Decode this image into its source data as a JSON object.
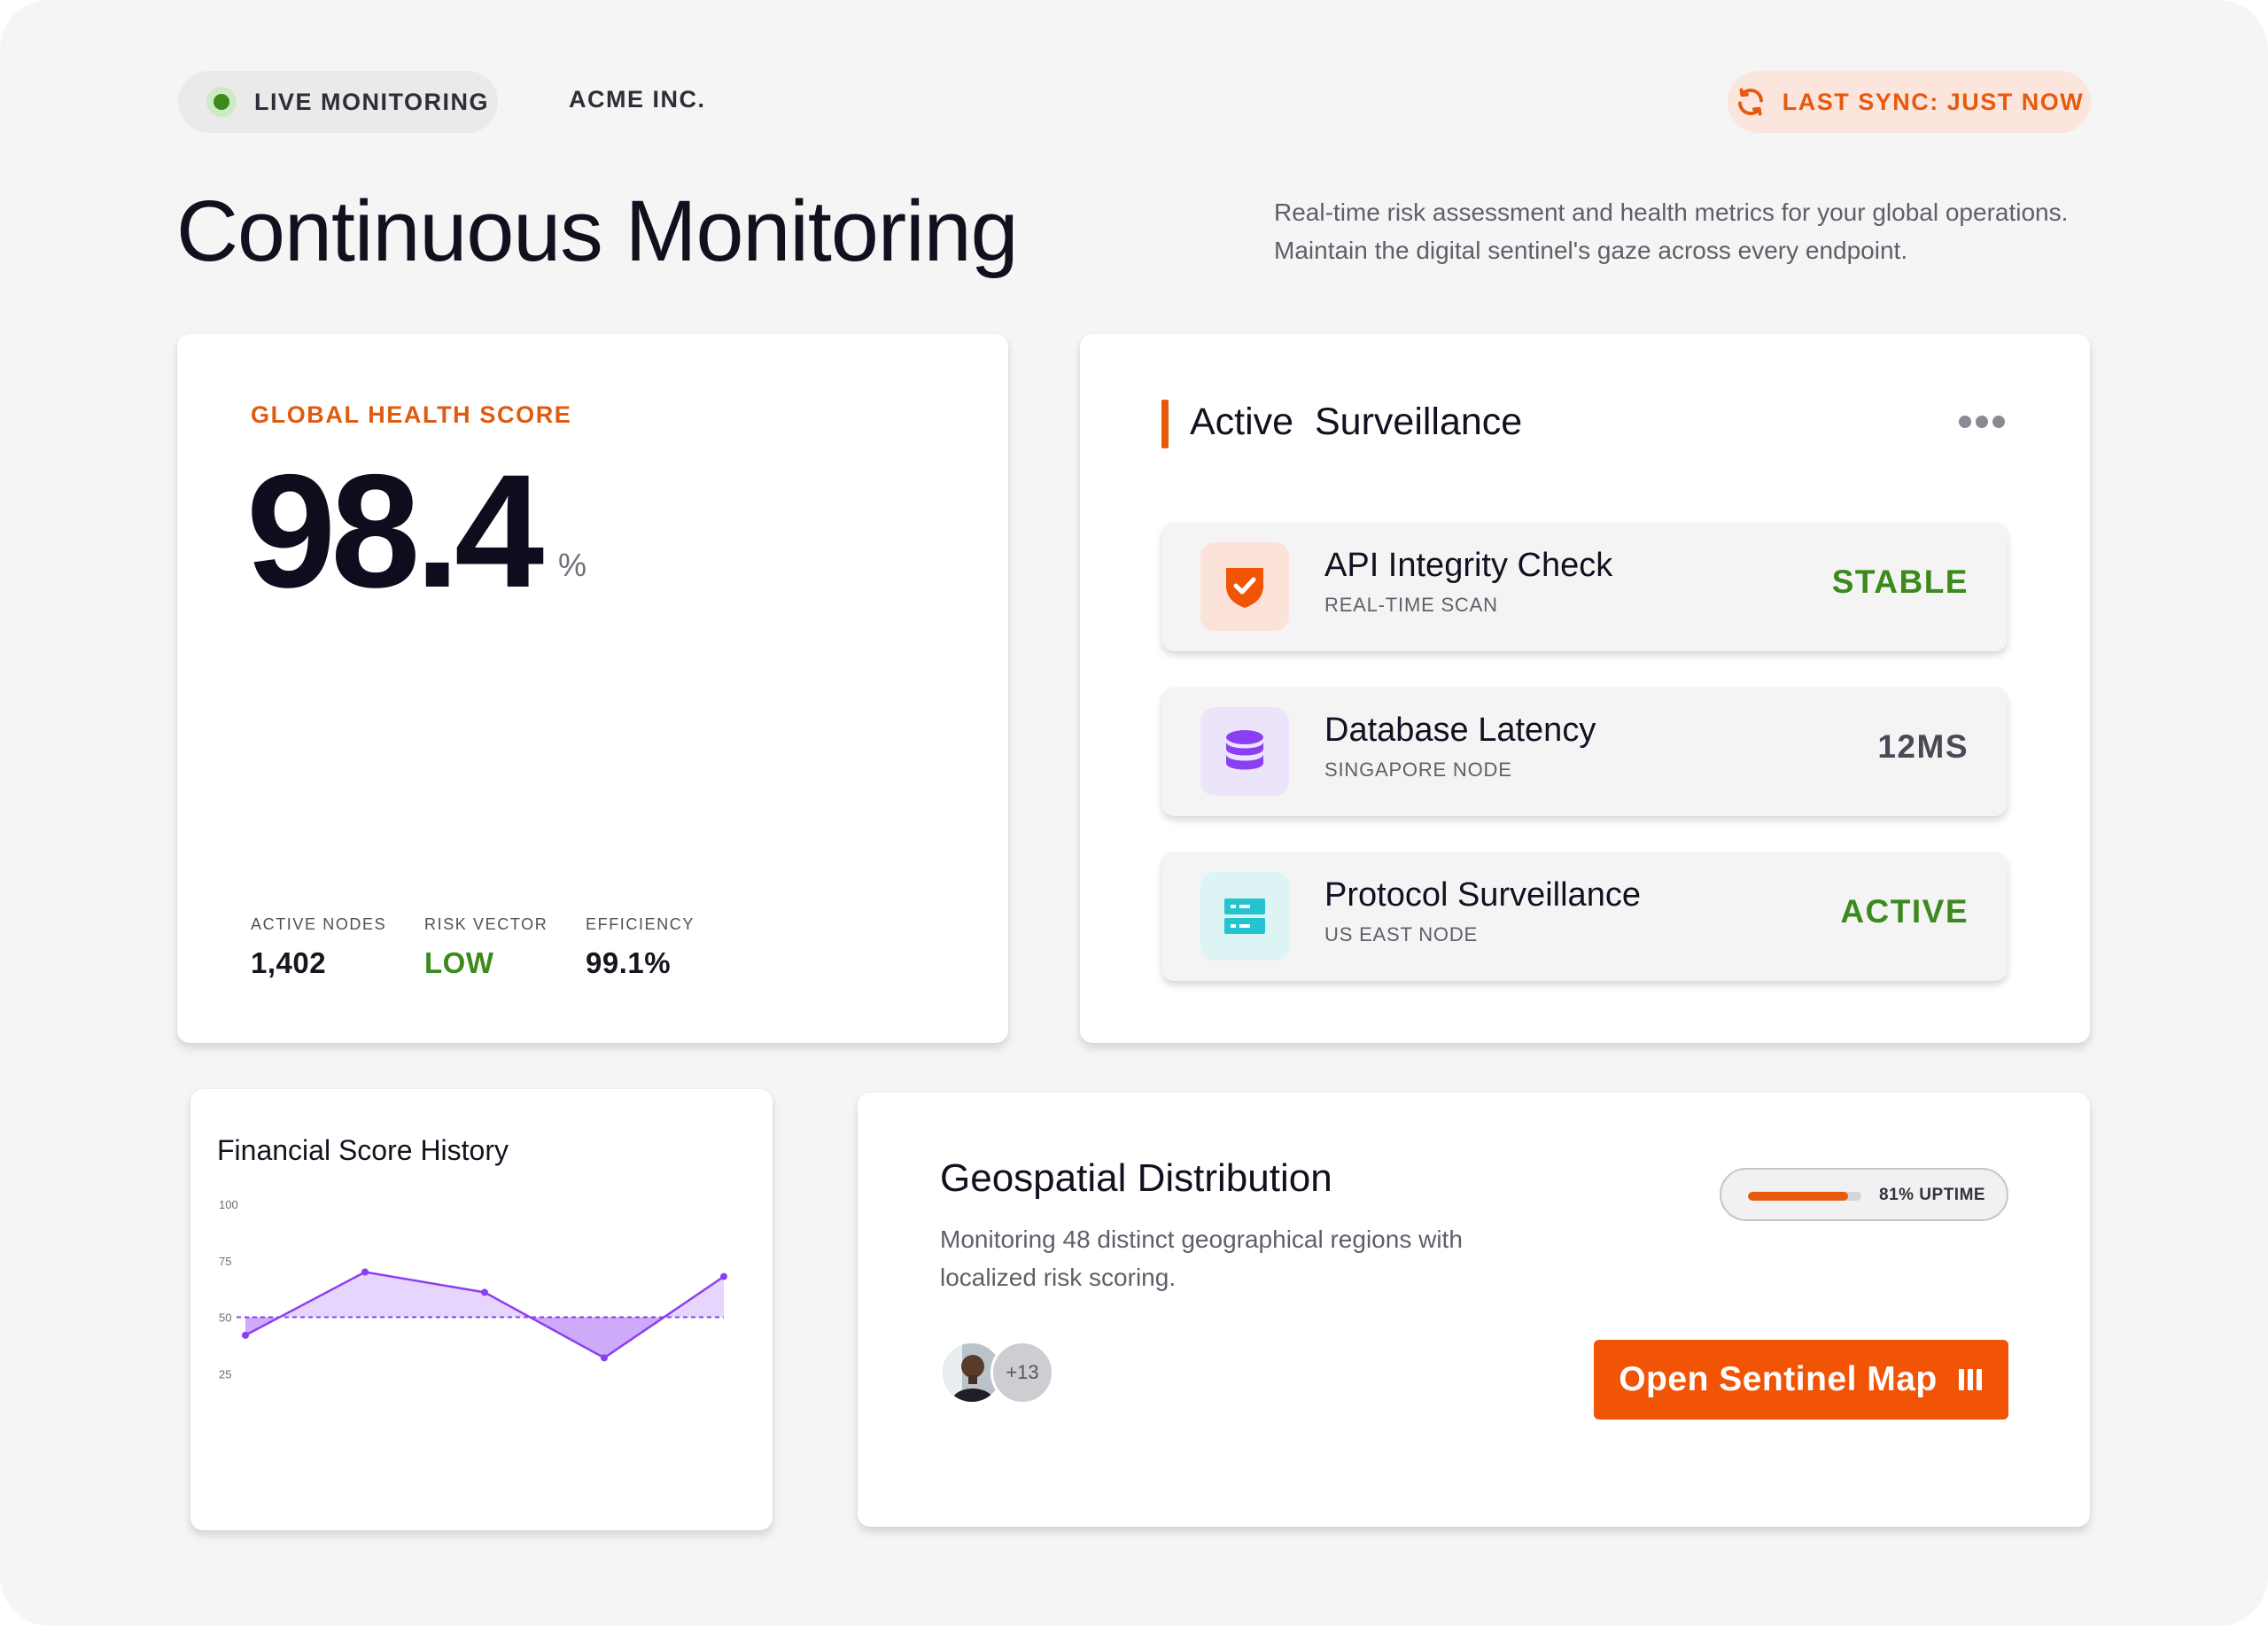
{
  "header": {
    "live_label": "LIVE MONITORING",
    "company": "ACME INC.",
    "sync_label": "LAST SYNC: JUST NOW",
    "live_color": "#3c8a1c",
    "accent_color": "#e8590c"
  },
  "page": {
    "title": "Continuous Monitoring",
    "description": "Real-time risk assessment and health metrics for your global operations. Maintain the digital sentinel's gaze across every endpoint."
  },
  "health": {
    "label": "GLOBAL HEALTH SCORE",
    "score": "98.4",
    "unit": "%",
    "stats": [
      {
        "label": "ACTIVE NODES",
        "value": "1,402"
      },
      {
        "label": "RISK VECTOR",
        "value": "LOW"
      },
      {
        "label": "EFFICIENCY",
        "value": "99.1%"
      }
    ]
  },
  "surveillance": {
    "title": "Active  Surveillance",
    "more_icon": "more-horizontal-icon",
    "items": [
      {
        "name": "API Integrity Check",
        "sub": "REAL-TIME SCAN",
        "status": "STABLE",
        "icon": "shield-check-icon",
        "status_color": "#3c8a1c",
        "icon_bg": "#fbe3da",
        "icon_color": "#f25406"
      },
      {
        "name": "Database Latency",
        "sub": "SINGAPORE NODE",
        "status": "12MS",
        "icon": "database-icon",
        "status_color": "#4a4a55",
        "icon_bg": "#ece4fb",
        "icon_color": "#8b3ff2"
      },
      {
        "name": "Protocol Surveillance",
        "sub": "US EAST NODE",
        "status": "ACTIVE",
        "icon": "server-icon",
        "status_color": "#3c8a1c",
        "icon_bg": "#ddf4f4",
        "icon_color": "#25c3d0"
      }
    ]
  },
  "financial": {
    "title": "Financial Score History",
    "chart_data": {
      "type": "area",
      "title": "Financial Score History",
      "y_ticks": [
        "100",
        "75",
        "50",
        "25"
      ],
      "ylim": [
        0,
        100
      ],
      "baseline": 50,
      "x": [
        0,
        1,
        2,
        3,
        4
      ],
      "values": [
        42,
        70,
        61,
        32,
        68
      ],
      "series_color": "#8b3ff2",
      "grid": false
    }
  },
  "geo": {
    "title": "Geospatial Distribution",
    "description": "Monitoring 48 distinct geographical regions with localized risk scoring.",
    "uptime_label": "81% UPTIME",
    "uptime_fraction": 0.88,
    "avatar_more": "+13",
    "button_label": "Open Sentinel Map",
    "button_icon": "map-columns-icon"
  }
}
